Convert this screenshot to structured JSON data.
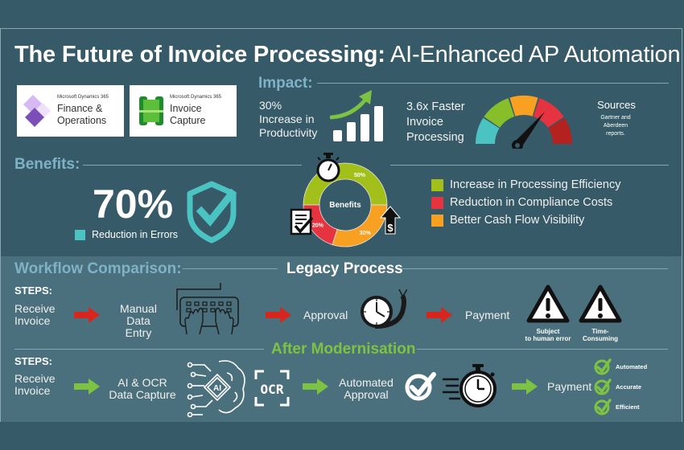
{
  "header": {
    "title_bold": "The Future of Invoice Processing:",
    "title_light": "AI-Enhanced AP Automation"
  },
  "logos": [
    {
      "vendor": "Microsoft Dynamics 365",
      "product_line1": "Finance &",
      "product_line2": "Operations",
      "icon": "finance-operations-icon"
    },
    {
      "vendor": "Microsoft Dynamics 365",
      "product_line1": "Invoice",
      "product_line2": "Capture",
      "icon": "invoice-capture-icon"
    }
  ],
  "impact": {
    "heading": "Impact:",
    "productivity": {
      "value": "30%",
      "line1": "Increase in",
      "line2": "Productivity",
      "icon": "growth-chart-icon"
    },
    "speed": {
      "line1": "3.6x Faster",
      "line2": "Invoice",
      "line3": "Processing",
      "icon": "speedometer-gauge-icon"
    },
    "sources": {
      "heading": "Sources",
      "line1": "Gartner and",
      "line2": "Aberdeen",
      "line3": "reports."
    }
  },
  "benefits": {
    "heading": "Benefits:",
    "errors": {
      "value": "70%",
      "label": "Reduction in Errors",
      "color": "#4cc3c3",
      "icon": "shield-check-icon"
    },
    "donut_center": "Benefits",
    "legend": [
      {
        "label": "Increase in Processing Efficiency",
        "color": "#a2bf1a"
      },
      {
        "label": "Reduction in Compliance Costs",
        "color": "#e5343f"
      },
      {
        "label": "Better Cash Flow Visibility",
        "color": "#f7a021"
      }
    ]
  },
  "chart_data": {
    "type": "pie",
    "title": "Benefits",
    "categories": [
      "Increase in Processing Efficiency",
      "Better Cash Flow Visibility",
      "Reduction in Compliance Costs"
    ],
    "values": [
      50,
      30,
      20
    ],
    "labels": [
      "50%",
      "30%",
      "20%"
    ],
    "colors": [
      "#a2bf1a",
      "#f7a021",
      "#e5343f"
    ],
    "legend": "right"
  },
  "workflow": {
    "heading": "Workflow Comparison:",
    "legacy": {
      "heading": "Legacy Process",
      "steps_label": "STEPS:",
      "steps": [
        {
          "line1": "Receive",
          "line2": "Invoice"
        },
        {
          "line1": "Manual",
          "line2": "Data Entry"
        },
        {
          "line1": "Approval",
          "line2": ""
        },
        {
          "line1": "Payment",
          "line2": ""
        }
      ],
      "warnings": [
        {
          "line1": "Subject",
          "line2": "to human error"
        },
        {
          "line1": "Time-",
          "line2": "Consuming"
        }
      ],
      "arrow_color": "#d8261f"
    },
    "modern": {
      "heading": "After Modernisation",
      "steps_label": "STEPS:",
      "steps": [
        {
          "line1": "Receive",
          "line2": "Invoice"
        },
        {
          "line1": "AI & OCR",
          "line2": "Data Capture"
        },
        {
          "line1": "Automated",
          "line2": "Approval"
        },
        {
          "line1": "Payment",
          "line2": ""
        }
      ],
      "ocr_label": "OCR",
      "ai_label": "AI",
      "checks": [
        "Automated",
        "Accurate",
        "Efficient"
      ],
      "arrow_color": "#7dc242",
      "accent": "#7dc242"
    }
  }
}
